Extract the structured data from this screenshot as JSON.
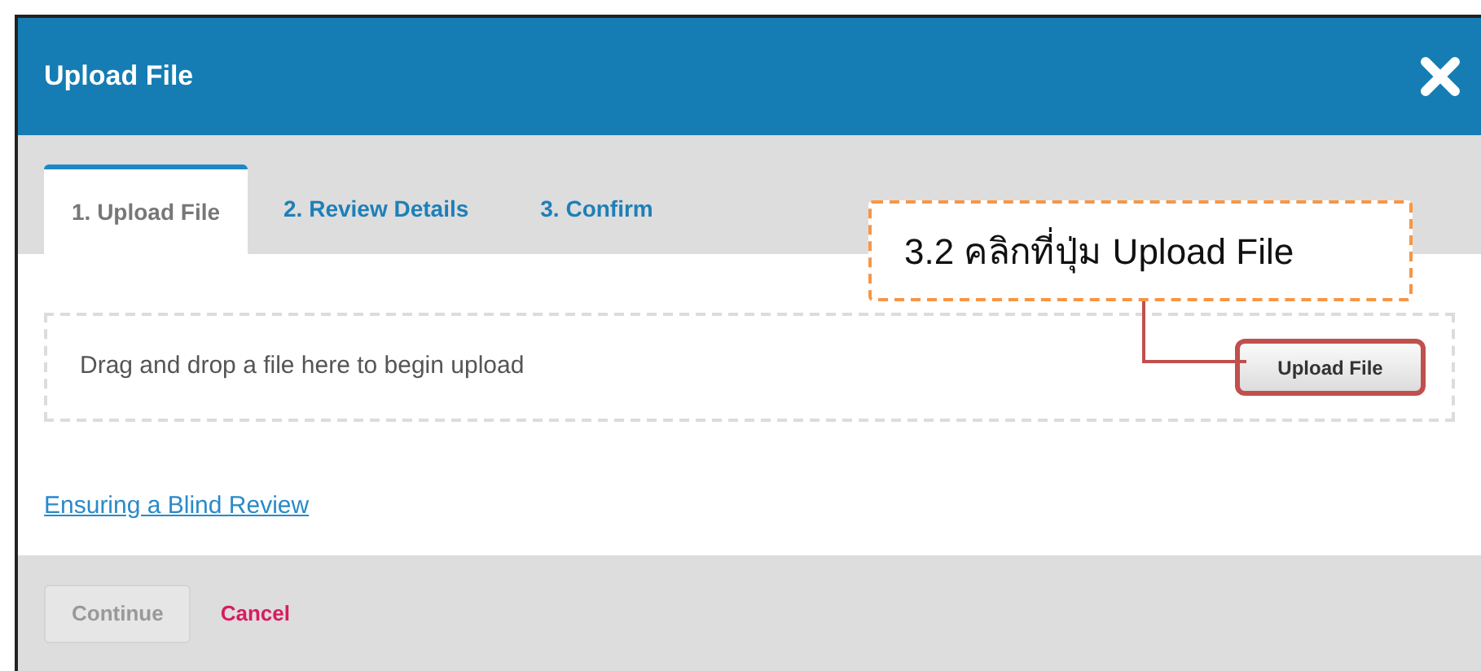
{
  "dialog": {
    "title": "Upload File"
  },
  "tabs": [
    {
      "label": "1. Upload File",
      "selected": true
    },
    {
      "label": "2. Review Details",
      "selected": false
    },
    {
      "label": "3. Confirm",
      "selected": false
    }
  ],
  "dropzone": {
    "hint": "Drag and drop a file here to begin upload",
    "button": "Upload File"
  },
  "callout": {
    "text": "3.2 คลิกที่ปุ่ม Upload File"
  },
  "link": "Ensuring a Blind Review",
  "footer": {
    "continue": {
      "label": "Continue",
      "disabled": true
    },
    "cancel": "Cancel"
  }
}
